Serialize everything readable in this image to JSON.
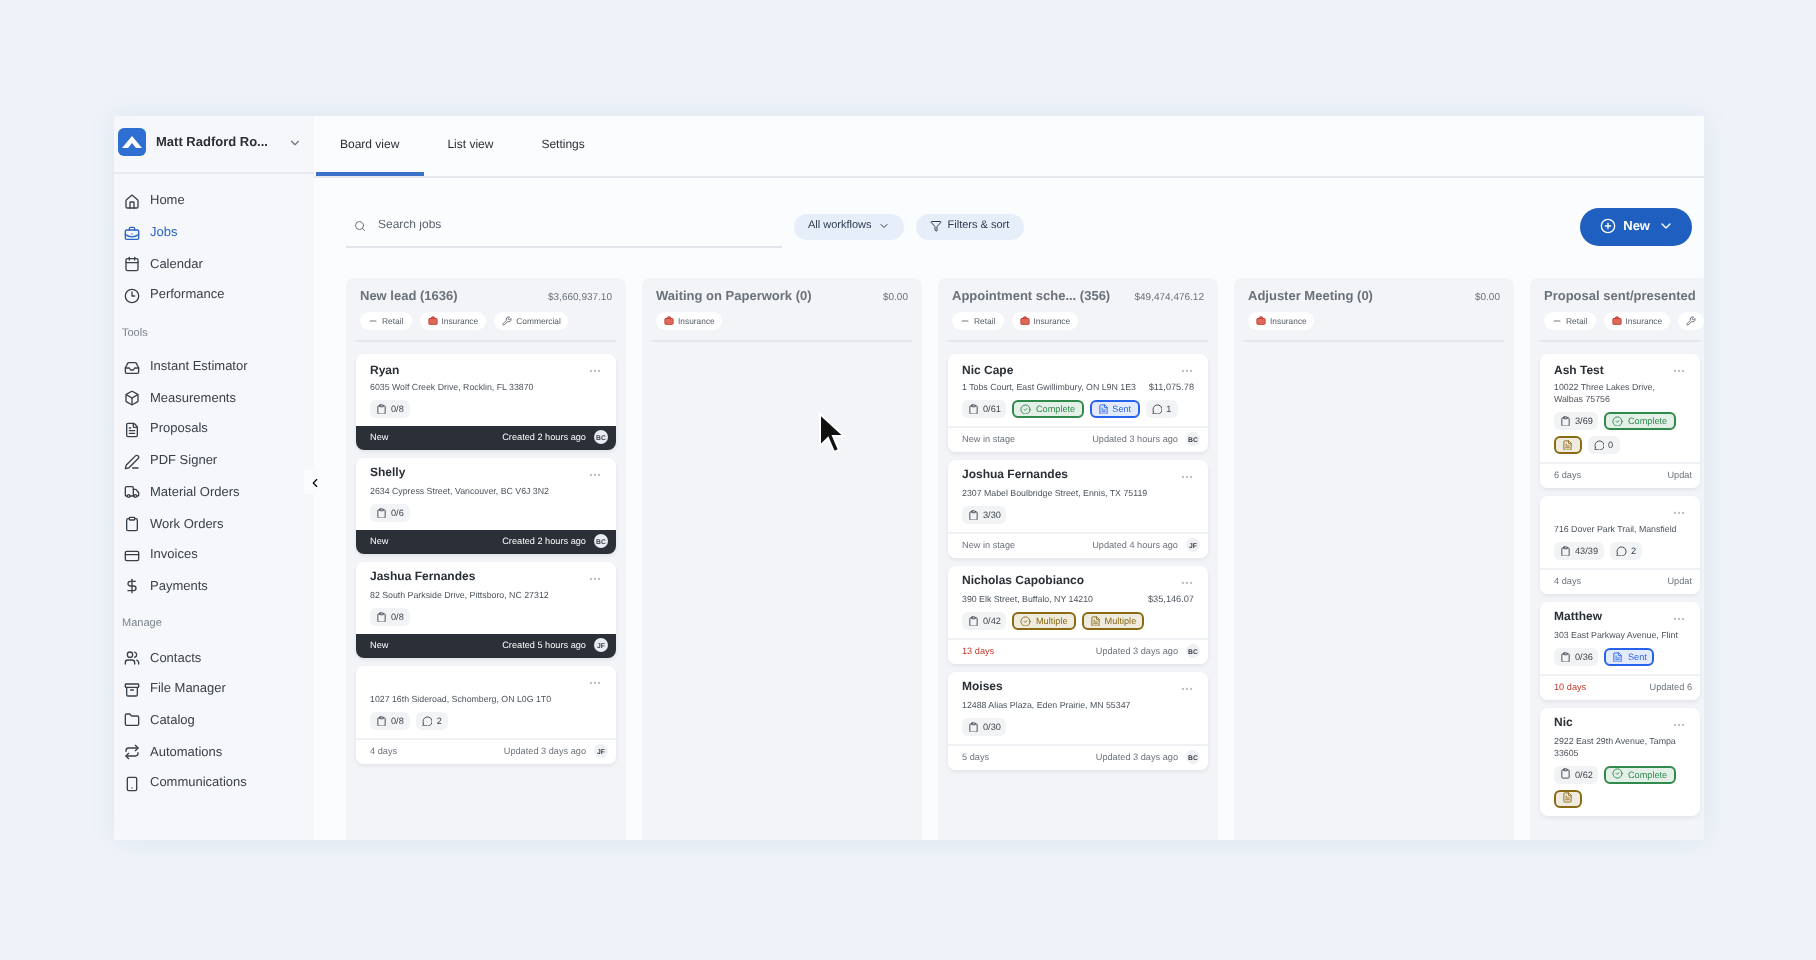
{
  "sidebar": {
    "account": {
      "name": "Matt Radford Ro..."
    },
    "groups": [
      {
        "items": [
          {
            "label": "Home",
            "selected": false
          },
          {
            "label": "Jobs",
            "selected": true
          },
          {
            "label": "Calendar",
            "selected": false
          },
          {
            "label": "Performance",
            "selected": false
          }
        ]
      },
      {
        "heading": "Tools",
        "items": [
          {
            "label": "Instant Estimator",
            "selected": false
          },
          {
            "label": "Measurements",
            "selected": false
          },
          {
            "label": "Proposals",
            "selected": false
          },
          {
            "label": "PDF Signer",
            "selected": false
          },
          {
            "label": "Material Orders",
            "selected": false
          },
          {
            "label": "Work Orders",
            "selected": false
          },
          {
            "label": "Invoices",
            "selected": false
          },
          {
            "label": "Payments",
            "selected": false
          }
        ]
      },
      {
        "heading": "Manage",
        "items": [
          {
            "label": "Contacts",
            "selected": false
          },
          {
            "label": "File Manager",
            "selected": false
          },
          {
            "label": "Catalog",
            "selected": false
          },
          {
            "label": "Automations",
            "selected": false
          },
          {
            "label": "Communications",
            "selected": false
          }
        ]
      }
    ]
  },
  "tabs": [
    {
      "label": "Board view",
      "selected": true
    },
    {
      "label": "List view",
      "selected": false
    },
    {
      "label": "Settings",
      "selected": false
    }
  ],
  "toolbar": {
    "search": {
      "placeholder": "Search jobs"
    },
    "workflows": "All workflows",
    "filters": "Filters & sort",
    "new": "New"
  },
  "columns": [
    {
      "title": "New lead (1636)",
      "total": "$3,660,937.10",
      "tags": [
        {
          "kind": "retail",
          "label": "Retail"
        },
        {
          "kind": "insurance",
          "label": "Insurance"
        },
        {
          "kind": "commercial",
          "label": "Commercial"
        }
      ],
      "cards": [
        {
          "title": "Ryan",
          "address": "6035 Wolf Creek Drive, Rocklin, FL 33870",
          "chips": [
            {
              "kind": "tasks",
              "label": "0/8"
            }
          ],
          "footer": {
            "kind": "created",
            "left": "New",
            "time": "Created 2 hours ago",
            "avatar": "BC"
          }
        },
        {
          "title": "Shelly",
          "address": "2634 Cypress Street, Vancouver, BC V6J 3N2",
          "chips": [
            {
              "kind": "tasks",
              "label": "0/6"
            }
          ],
          "footer": {
            "kind": "created",
            "left": "New",
            "time": "Created 2 hours ago",
            "avatar": "BC"
          }
        },
        {
          "title": "Jashua Fernandes",
          "address": "82 South Parkside Drive, Pittsboro, NC 27312",
          "chips": [
            {
              "kind": "tasks",
              "label": "0/8"
            }
          ],
          "footer": {
            "kind": "created",
            "left": "New",
            "time": "Created 5 hours ago",
            "avatar": "JF"
          }
        },
        {
          "address": "1027 16th Sideroad, Schomberg, ON L0G 1T0",
          "chips": [
            {
              "kind": "tasks",
              "label": "0/8"
            },
            {
              "kind": "comments",
              "label": "2"
            }
          ],
          "footer": {
            "kind": "updated",
            "left": "4 days",
            "overdue": false,
            "time": "Updated 3 days ago",
            "avatar": "JF"
          }
        }
      ]
    },
    {
      "title": "Waiting on Paperwork (0)",
      "total": "$0.00",
      "tags": [
        {
          "kind": "insurance",
          "label": "Insurance"
        }
      ]
    },
    {
      "title": "Appointment sche...  (356)",
      "total": "$49,474,476.12",
      "tags": [
        {
          "kind": "retail",
          "label": "Retail"
        },
        {
          "kind": "insurance",
          "label": "Insurance"
        }
      ],
      "cards": [
        {
          "title": "Nic Cape",
          "address": "1 Tobs Court, East Gwillimbury, ON L9N 1E3",
          "amount": "$11,075.78",
          "chips": [
            {
              "kind": "tasks",
              "label": "0/61"
            },
            {
              "kind": "check",
              "label": "Complete",
              "color": "#2f8a4c"
            },
            {
              "kind": "doc",
              "label": "Sent",
              "color": "#2563eb"
            },
            {
              "kind": "comments",
              "label": "1"
            }
          ],
          "footer": {
            "kind": "updated",
            "left": "New in stage",
            "overdue": false,
            "time": "Updated 3 hours ago",
            "avatar": "BC"
          }
        },
        {
          "title": "Joshua Fernandes",
          "address": "2307 Mabel Boulbridge Street, Ennis, TX 75119",
          "chips": [
            {
              "kind": "tasks",
              "label": "3/30"
            }
          ],
          "footer": {
            "kind": "updated",
            "left": "New in stage",
            "overdue": false,
            "time": "Updated 4 hours ago",
            "avatar": "JF"
          }
        },
        {
          "title": "Nicholas Capobianco",
          "address": "390 Elk Street, Buffalo, NY 14210",
          "amount": "$35,146.07",
          "chips": [
            {
              "kind": "tasks",
              "label": "0/42"
            },
            {
              "kind": "check",
              "label": "Multiple",
              "color": "#8a6a12"
            },
            {
              "kind": "doc",
              "label": "Multiple",
              "color": "#8a6a12"
            }
          ],
          "footer": {
            "kind": "updated",
            "left": "13 days",
            "overdue": true,
            "time": "Updated 3 days ago",
            "avatar": "BC"
          }
        },
        {
          "title": "Moises",
          "address": "12488 Alias Plaza, Eden Prairie, MN 55347",
          "chips": [
            {
              "kind": "tasks",
              "label": "0/30"
            }
          ],
          "footer": {
            "kind": "updated",
            "left": "5 days",
            "overdue": false,
            "time": "Updated 3 days ago",
            "avatar": "BC"
          }
        }
      ]
    },
    {
      "title": "Adjuster Meeting (0)",
      "total": "$0.00",
      "tags": [
        {
          "kind": "insurance",
          "label": "Insurance"
        }
      ]
    },
    {
      "title": "Proposal sent/presented",
      "tags": [
        {
          "kind": "retail",
          "label": "Retail"
        },
        {
          "kind": "insurance",
          "label": "Insurance"
        },
        {
          "kind": "commercial"
        }
      ],
      "cards": [
        {
          "title": "Ash Test",
          "address": "10022 Three Lakes Drive, Walbas 75756",
          "chips": [
            {
              "kind": "tasks",
              "label": "3/69"
            },
            {
              "kind": "check",
              "label": "Complete",
              "color": "#2f8a4c"
            },
            {
              "kind": "doc",
              "color": "#8a6a12"
            },
            {
              "kind": "comments",
              "label": "0"
            }
          ],
          "footer": {
            "kind": "updated",
            "left": "6 days",
            "overdue": false,
            "time": "Updat"
          }
        },
        {
          "address": "716 Dover Park Trail, Mansfield",
          "chips": [
            {
              "kind": "tasks",
              "label": "43/39"
            },
            {
              "kind": "comments",
              "label": "2"
            }
          ],
          "footer": {
            "kind": "updated",
            "left": "4 days",
            "overdue": false,
            "time": "Updat"
          }
        },
        {
          "title": "Matthew",
          "address": "303 East Parkway Avenue, Flint",
          "chips": [
            {
              "kind": "tasks",
              "label": "0/36"
            },
            {
              "kind": "doc",
              "label": "Sent",
              "color": "#2563eb"
            }
          ],
          "footer": {
            "kind": "updated",
            "left": "10 days",
            "overdue": true,
            "time": "Updated 6"
          }
        },
        {
          "title": "Nic",
          "address": "2922 East 29th Avenue, Tampa 33605",
          "chips": [
            {
              "kind": "tasks",
              "label": "0/62"
            },
            {
              "kind": "check",
              "label": "Complete",
              "color": "#2f8a4c"
            },
            {
              "kind": "doc",
              "color": "#8a6a12"
            }
          ]
        }
      ]
    }
  ]
}
